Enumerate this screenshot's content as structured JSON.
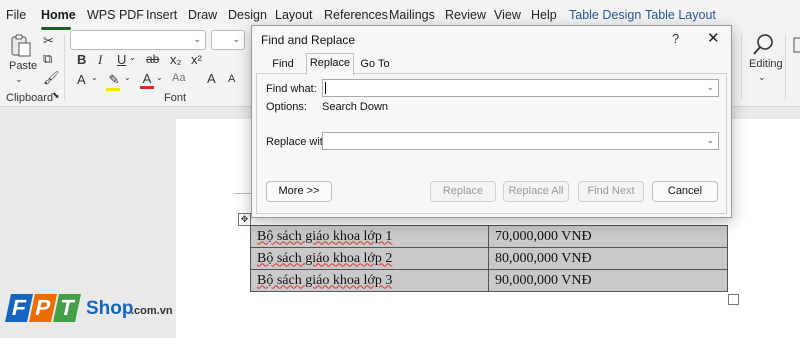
{
  "ribbon_tabs": {
    "file": "File",
    "home": "Home",
    "wps_pdf": "WPS PDF",
    "insert": "Insert",
    "draw": "Draw",
    "design": "Design",
    "layout": "Layout",
    "references": "References",
    "mailings": "Mailings",
    "review": "Review",
    "view": "View",
    "help": "Help",
    "table_design": "Table Design",
    "table_layout": "Table Layout"
  },
  "ribbon": {
    "paste_label": "Paste",
    "clipboard_label": "Clipboard",
    "font_label": "Font",
    "editing_label": "Editing",
    "bold": "B",
    "italic": "I",
    "underline": "U",
    "strikethrough": "ab",
    "subscript": "x₂",
    "superscript": "x²",
    "font_color_glyph": "A",
    "grow_font": "A",
    "shrink_font": "A",
    "change_case": "Aa"
  },
  "colors": {
    "accent_green": "#1b5e20",
    "context_tab_blue": "#2b5797",
    "highlight_yellow": "#f2e600",
    "font_red": "#d32f2f",
    "logo_blue": "#1565c0",
    "logo_green": "#43a047",
    "logo_orange": "#ef6c00"
  },
  "table": {
    "rows": [
      {
        "item": "Bộ sách giáo khoa lớp 1",
        "price": "70,000,000 VNĐ"
      },
      {
        "item": "Bộ sách giáo khoa lớp 2",
        "price": "80,000,000 VNĐ"
      },
      {
        "item": "Bộ sách giáo khoa lớp 3",
        "price": "90,000,000 VNĐ"
      }
    ]
  },
  "logo": {
    "letters": [
      "F",
      "P",
      "T"
    ],
    "word": "Shop",
    "domain": ".com.vn"
  },
  "dialog": {
    "title": "Find and Replace",
    "help": "?",
    "close": "✕",
    "tabs": {
      "find": "Find",
      "replace": "Replace",
      "goto": "Go To"
    },
    "find_label": "Find what:",
    "find_value": "",
    "options_label": "Options:",
    "options_value": "Search Down",
    "replace_label": "Replace with:",
    "replace_value": "",
    "buttons": {
      "more": "More >>",
      "replace": "Replace",
      "replace_all": "Replace All",
      "find_next": "Find Next",
      "cancel": "Cancel"
    }
  }
}
